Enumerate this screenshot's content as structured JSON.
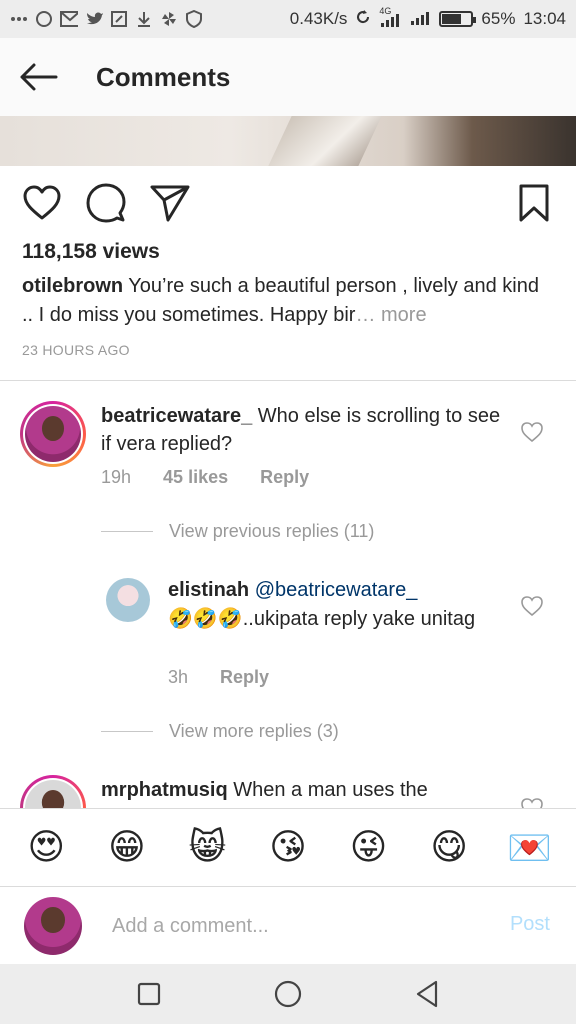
{
  "status_bar": {
    "speed": "0.43K/s",
    "network": "4G",
    "battery": "65%",
    "battery_level": 0.65,
    "time": "13:04"
  },
  "header": {
    "title": "Comments"
  },
  "post": {
    "views": "118,158 views",
    "caption_user": "otilebrown",
    "caption_text": " You’re such a beautiful person , lively and kind .. I do miss you sometimes. Happy bir",
    "caption_more": "… more",
    "timestamp": "23 HOURS AGO"
  },
  "comments": [
    {
      "username": "beatricewatare_",
      "text": " Who else is scrolling to see if vera replied?",
      "time": "19h",
      "likes": "45 likes",
      "reply": "Reply"
    }
  ],
  "view_previous_replies": "View previous replies (11)",
  "reply": {
    "username": "elistinah",
    "mention": "@beatricewatare_",
    "emojis": "🤣🤣🤣",
    "text": "..ukipata reply yake unitag",
    "time": "3h",
    "reply": "Reply"
  },
  "view_more_replies": "View more replies (3)",
  "partial_comment": {
    "username": "mrphatmusiq",
    "text": " When a man uses the"
  },
  "emoji_bar": [
    "😍",
    "😁",
    "😸",
    "😘",
    "😜",
    "😋",
    "💌"
  ],
  "comment_input": {
    "placeholder": "Add a comment...",
    "post_label": "Post"
  },
  "colors": {
    "accent_blue": "#3897f0",
    "post_disabled": "#b2dffc",
    "mention": "#003569"
  }
}
